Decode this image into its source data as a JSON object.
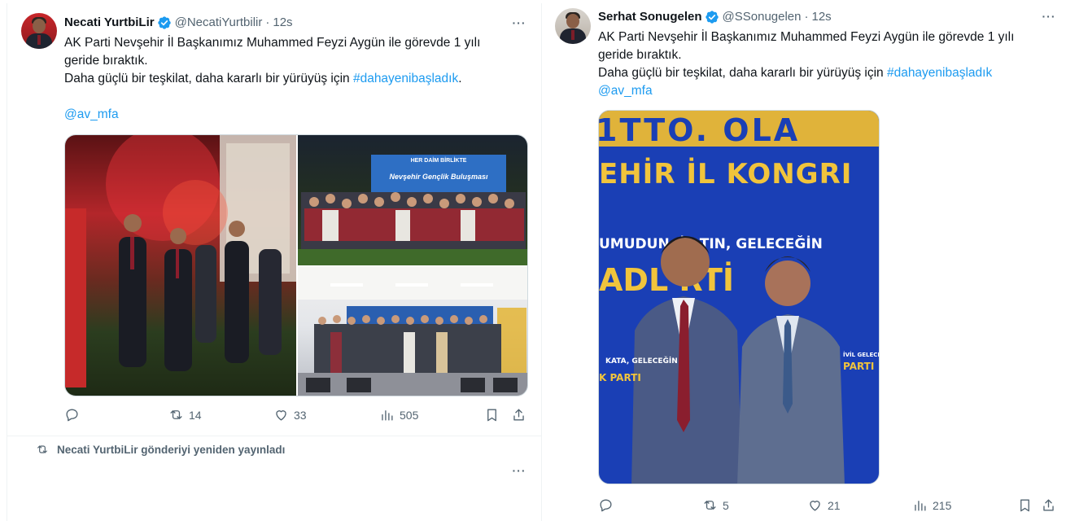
{
  "tweet1": {
    "name": "Necati YurtbiLir",
    "handle": "@NecatiYurtbilir",
    "dot": "·",
    "time": "12s",
    "line1": "AK Parti Nevşehir İl Başkanımız Muhammed Feyzi Aygün ile görevde 1 yılı",
    "line2": "geride bıraktık.",
    "line3": "Daha güçlü bir teşkilat, daha kararlı bir yürüyüş için",
    "hashtag": "#dahayenibaşladık",
    "period": ".",
    "mention": "@av_mfa",
    "photo_banner": "HER DAİM BİRLİKTE",
    "photo_banner_sub": "Nevşehir Gençlik Buluşması",
    "replies": "",
    "reposts": "14",
    "likes": "33",
    "views": "505"
  },
  "repost_notice": "Necati YurtbiLir gönderiyi yeniden yayınladı",
  "tweet2": {
    "name": "Serhat Sonugelen",
    "handle": "@SSonugelen",
    "dot": "·",
    "time": "12s",
    "line1": "AK Parti Nevşehir İl Başkanımız Muhammed Feyzi Aygün ile görevde 1 yılı",
    "line2": "geride bıraktık.",
    "line3": "Daha güçlü bir teşkilat, daha kararlı bir yürüyüş için",
    "hashtag": "#dahayenibaşladık",
    "mention": "@av_mfa",
    "photo_top": "1TTO. OLA",
    "photo_line1": "EHİR İL KONGRI",
    "photo_line2": "UMUDUN, İÇ   TIN, GELECEĞİN",
    "photo_line3": "ADL     RTİ",
    "replies": "",
    "reposts": "5",
    "likes": "21",
    "views": "215"
  },
  "colors": {
    "accent": "#1d9bf0",
    "muted": "#536471",
    "text": "#0f1419",
    "border": "#cfd9de"
  },
  "icons": [
    "verified-badge-icon",
    "more-icon",
    "reply-icon",
    "repost-icon",
    "like-icon",
    "views-icon",
    "bookmark-icon",
    "share-icon"
  ]
}
